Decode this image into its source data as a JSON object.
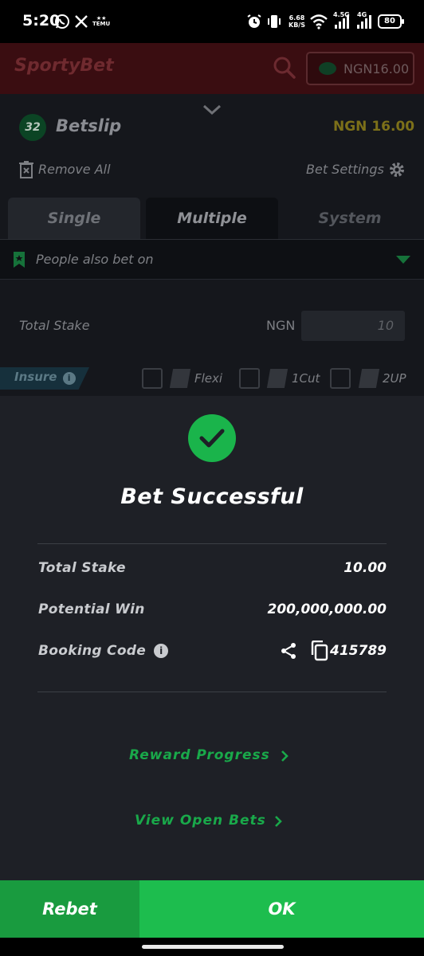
{
  "status_bar": {
    "time": "5:20",
    "notification_app_label": "TEMU",
    "net_speed_value": "6.68",
    "net_speed_unit": "KB/S",
    "network_1": "4.5G",
    "network_2": "4G",
    "battery": "80"
  },
  "header": {
    "logo": "SportyBet",
    "balance": "NGN16.00"
  },
  "betslip": {
    "count": "32",
    "title": "Betslip",
    "balance": "NGN 16.00",
    "remove_all": "Remove All",
    "bet_settings": "Bet Settings",
    "tabs": [
      {
        "label": "Single"
      },
      {
        "label": "Multiple"
      },
      {
        "label": "System"
      }
    ],
    "people_also_bet_on": "People also bet on",
    "total_stake_label": "Total Stake",
    "currency": "NGN",
    "stake_value": "10",
    "insure_label": "Insure",
    "options": [
      {
        "label": "Flexi"
      },
      {
        "label": "1Cut"
      },
      {
        "label": "2UP"
      }
    ]
  },
  "modal": {
    "title": "Bet Successful",
    "rows": [
      {
        "label": "Total Stake",
        "value": "10.00"
      },
      {
        "label": "Potential Win",
        "value": "200,000,000.00"
      },
      {
        "label": "Booking Code",
        "value": "415789"
      }
    ],
    "reward_progress": "Reward Progress",
    "view_open_bets": "View Open Bets"
  },
  "footer": {
    "rebet": "Rebet",
    "ok": "OK"
  },
  "colors": {
    "accent_green": "#1dbd4e",
    "brand_red": "#3a0d11",
    "modal_bg": "#1e2026",
    "balance_yellow": "#7c7019"
  },
  "icons": [
    "whatsapp-icon",
    "x-icon",
    "alarm-icon",
    "vibrate-icon",
    "wifi-icon",
    "search-icon",
    "wallet-icon",
    "chevron-down-icon",
    "trash-icon",
    "gear-icon",
    "bookmark-icon",
    "info-icon",
    "checkmark-icon",
    "share-icon",
    "copy-icon",
    "chevron-right-icon"
  ]
}
